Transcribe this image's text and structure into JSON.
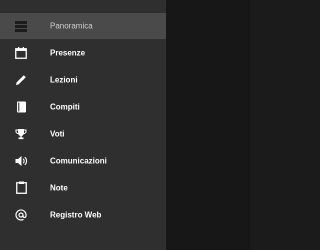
{
  "drawer": {
    "items": [
      {
        "label": "Panoramica",
        "icon": "list-icon",
        "active": true
      },
      {
        "label": "Presenze",
        "icon": "calendar-icon"
      },
      {
        "label": "Lezioni",
        "icon": "pencil-icon"
      },
      {
        "label": "Compiti",
        "icon": "book-icon"
      },
      {
        "label": "Voti",
        "icon": "trophy-icon"
      },
      {
        "label": "Comunicazioni",
        "icon": "speaker-icon"
      },
      {
        "label": "Note",
        "icon": "clipboard-icon"
      },
      {
        "label": "Registro Web",
        "icon": "at-icon"
      }
    ]
  },
  "colors": {
    "drawer_bg": "#2f2f2f",
    "active_bg": "#4a4a4a",
    "scrim": "#171717",
    "text": "#ffffff"
  }
}
